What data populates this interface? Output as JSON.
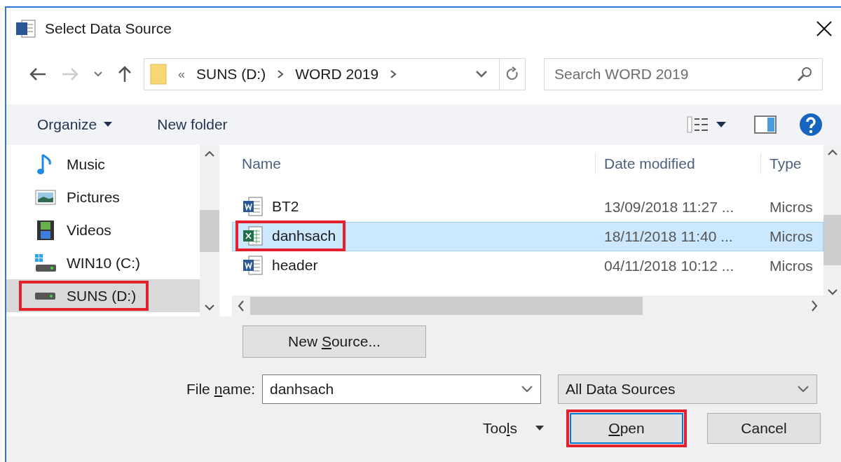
{
  "window": {
    "title": "Select Data Source"
  },
  "address": {
    "prefix": "«",
    "path": [
      "SUNS (D:)",
      "WORD 2019"
    ]
  },
  "search": {
    "placeholder": "Search WORD 2019"
  },
  "toolbar": {
    "organize": "Organize",
    "new_folder": "New folder"
  },
  "sidebar": {
    "items": [
      {
        "label": "Music",
        "kind": "music",
        "selected": false,
        "annotated": false
      },
      {
        "label": "Pictures",
        "kind": "pictures",
        "selected": false,
        "annotated": false
      },
      {
        "label": "Videos",
        "kind": "videos",
        "selected": false,
        "annotated": false
      },
      {
        "label": "WIN10 (C:)",
        "kind": "system-drive",
        "selected": false,
        "annotated": false
      },
      {
        "label": "SUNS (D:)",
        "kind": "drive",
        "selected": true,
        "annotated": true
      }
    ]
  },
  "file_list": {
    "columns": [
      "Name",
      "Date modified",
      "Type"
    ],
    "rows": [
      {
        "name": "BT2",
        "kind": "word",
        "date": "13/09/2018 11:27 ...",
        "type": "Micros",
        "selected": false,
        "annotated": false
      },
      {
        "name": "danhsach",
        "kind": "excel",
        "date": "18/11/2018 11:40 ...",
        "type": "Micros",
        "selected": true,
        "annotated": true
      },
      {
        "name": "header",
        "kind": "word",
        "date": "04/11/2018 10:12 ...",
        "type": "Micros",
        "selected": false,
        "annotated": false
      }
    ]
  },
  "new_source": {
    "label": [
      {
        "text": "New ",
        "underlined": false
      },
      {
        "text": "S",
        "underlined": true
      },
      {
        "text": "ource...",
        "underlined": false
      }
    ]
  },
  "file_name": {
    "label": [
      {
        "text": "File ",
        "underlined": false
      },
      {
        "text": "n",
        "underlined": true
      },
      {
        "text": "ame:",
        "underlined": false
      }
    ],
    "value": "danhsach"
  },
  "filter": {
    "value": "All Data Sources"
  },
  "tools": {
    "label": [
      {
        "text": "Too",
        "underlined": false
      },
      {
        "text": "l",
        "underlined": true
      },
      {
        "text": "s",
        "underlined": false
      }
    ]
  },
  "buttons": [
    {
      "label": [
        {
          "text": "O",
          "underlined": true
        },
        {
          "text": "pen",
          "underlined": false
        }
      ],
      "default": true,
      "annotated": true
    },
    {
      "label": [
        {
          "text": "Cancel",
          "underlined": false
        }
      ],
      "default": false,
      "annotated": false
    }
  ]
}
